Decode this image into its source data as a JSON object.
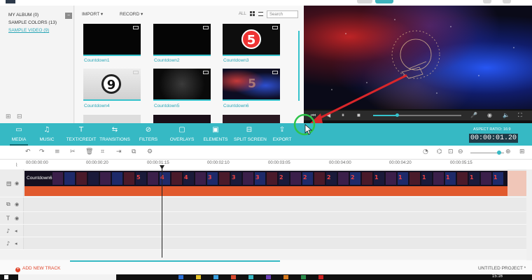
{
  "library": {
    "collections": [
      "MY ALBUM (0)",
      "SAMPLE COLORS (13)",
      "SAMPLE VIDEO (9)"
    ],
    "active_collection_index": 2
  },
  "media": {
    "import_label": "IMPORT",
    "record_label": "RECORD",
    "all_label": "ALL",
    "search_placeholder": "Search",
    "items": [
      {
        "label": "Countdown1"
      },
      {
        "label": "Countdown2"
      },
      {
        "label": "Countdown3",
        "overlay": "5"
      },
      {
        "label": "Countdown4",
        "overlay": "9"
      },
      {
        "label": "Countdown5"
      },
      {
        "label": "Countdown6",
        "overlay": "5"
      }
    ]
  },
  "player": {
    "progress": 0.27
  },
  "toolbar": {
    "items": [
      {
        "label": "MEDIA",
        "icon": "folder-icon",
        "active": true
      },
      {
        "label": "MUSIC",
        "icon": "music-icon"
      },
      {
        "label": "TEXT/CREDIT",
        "icon": "text-icon"
      },
      {
        "label": "TRANSITIONS",
        "icon": "transitions-icon"
      },
      {
        "label": "FILTERS",
        "icon": "filters-icon"
      },
      {
        "label": "OVERLAYS",
        "icon": "overlays-icon"
      },
      {
        "label": "ELEMENTS",
        "icon": "elements-icon"
      },
      {
        "label": "SPLIT SCREEN",
        "icon": "split-screen-icon"
      },
      {
        "label": "EXPORT",
        "icon": "export-icon"
      }
    ],
    "aspect_ratio": "ASPECT RATIO: 16:9",
    "timecode": "00:00:01.20"
  },
  "timeline": {
    "ruler": [
      "00:00:00:00",
      "00:00:00:20",
      "00:00:01:15",
      "00:00:02:10",
      "00:00:03:05",
      "00:00:04:00",
      "00:00:04:20",
      "00:00:05:15"
    ],
    "clip_name": "Countdown6",
    "add_track_label": "ADD NEW TRACK",
    "project_name": "UNTITLED PROJECT *"
  },
  "taskbar": {
    "clock": "15:16"
  },
  "colors": {
    "accent": "#36b9c4",
    "audio": "#e15a2e",
    "annotation_arrow": "#d9262a",
    "annotation_circle": "#2ec44a"
  }
}
